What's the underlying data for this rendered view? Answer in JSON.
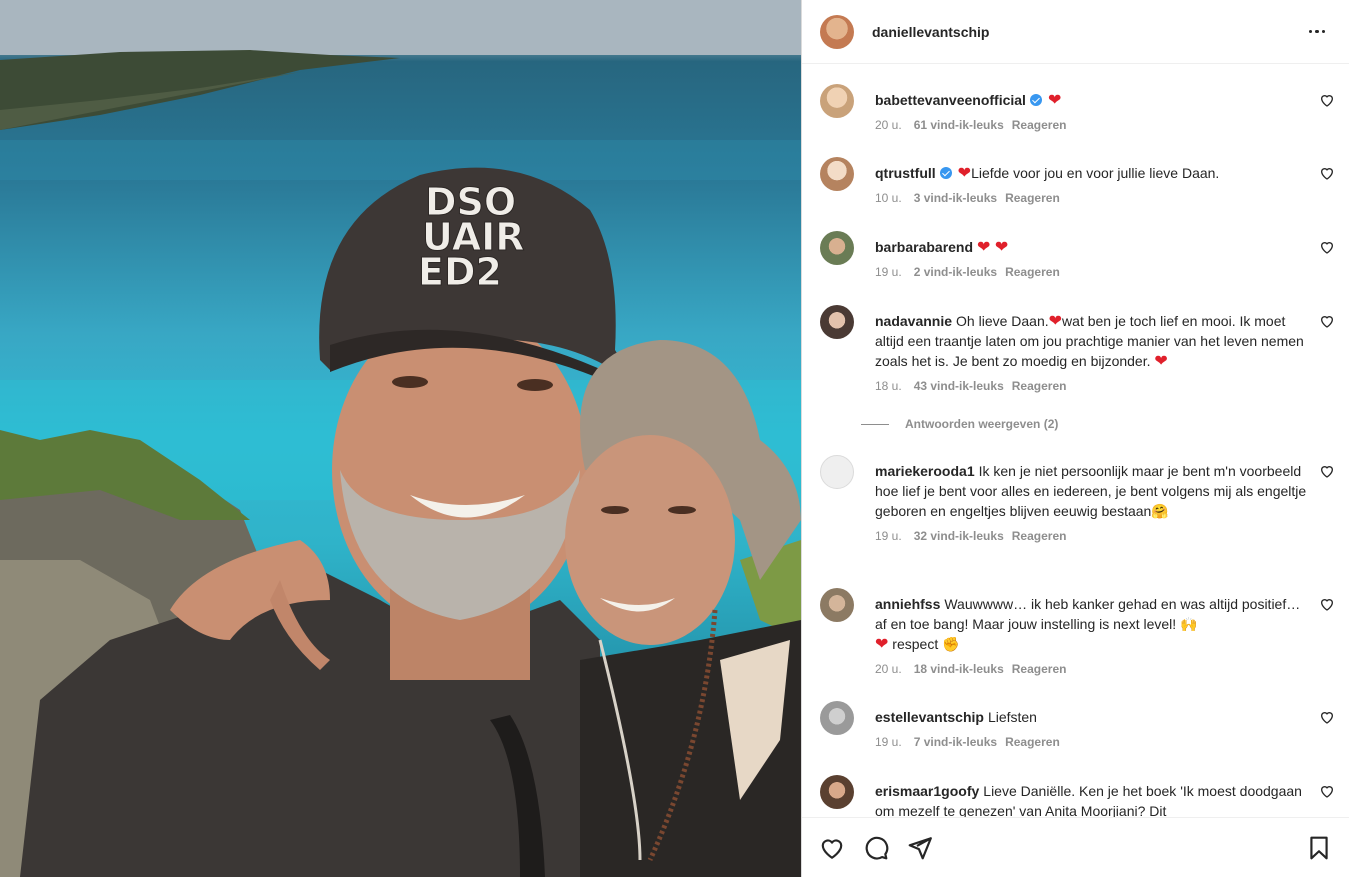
{
  "post": {
    "username": "daniellevantschip",
    "photo_icon": "selfie-photo"
  },
  "comments": [
    {
      "username": "babettevanveenofficial",
      "verified": true,
      "text": "",
      "emoji": "❤",
      "time": "20 u.",
      "likes": "61 vind-ik-leuks",
      "reply": "Reageren",
      "avatar_color": "#c9a27a"
    },
    {
      "username": "qtrustfull",
      "verified": true,
      "text": "Liefde voor jou en voor jullie lieve Daan.",
      "emoji_before": "❤",
      "time": "10 u.",
      "likes": "3 vind-ik-leuks",
      "reply": "Reageren",
      "avatar_color": "#b5835f"
    },
    {
      "username": "barbarabarend",
      "verified": false,
      "text": "",
      "emoji": "❤ ❤",
      "time": "19 u.",
      "likes": "2 vind-ik-leuks",
      "reply": "Reageren",
      "avatar_color": "#6a7c55"
    },
    {
      "username": "nadavannie",
      "verified": false,
      "text_part1": "Oh lieve Daan.",
      "text_part2": "wat ben je toch lief en mooi. Ik moet altijd een traantje laten om jou prachtige manier van het leven nemen zoals het is. Je bent zo moedig en bijzonder. ",
      "emoji": "❤",
      "time": "18 u.",
      "likes": "43 vind-ik-leuks",
      "reply": "Reageren",
      "avatar_color": "#4a3a34"
    },
    {
      "username": "mariekerooda1",
      "verified": false,
      "text": "Ik ken je niet persoonlijk maar je bent m'n voorbeeld hoe lief je bent voor alles en iedereen, je bent volgens mij als engeltje geboren en engeltjes blijven eeuwig bestaan",
      "emoji": "🤗",
      "time": "19 u.",
      "likes": "32 vind-ik-leuks",
      "reply": "Reageren",
      "avatar_color": "#dbdbdb"
    },
    {
      "username": "anniehfss",
      "verified": false,
      "text": "Wauwwww… ik heb kanker gehad en was altijd positief… af en toe bang! Maar jouw instelling is next level! ",
      "emoji": "🙌",
      "text_after": " respect ",
      "emoji2": "✊",
      "heart": "❤",
      "time": "20 u.",
      "likes": "18 vind-ik-leuks",
      "reply": "Reageren",
      "avatar_color": "#8c7a63"
    },
    {
      "username": "estellevantschip",
      "verified": false,
      "text": "Liefsten",
      "time": "19 u.",
      "likes": "7 vind-ik-leuks",
      "reply": "Reageren",
      "avatar_color": "#9a9a9a"
    },
    {
      "username": "erismaar1goofy",
      "verified": false,
      "text": "Lieve Daniëlle. Ken je het boek 'Ik moest doodgaan om mezelf te genezen' van Anita Moorjiani? Dit",
      "avatar_color": "#5a4030"
    }
  ],
  "replies_toggle": "Antwoorden weergeven (2)",
  "colors": {
    "heart": "#e0202b",
    "meta": "#8e8e8e",
    "verified": "#3897f0"
  }
}
